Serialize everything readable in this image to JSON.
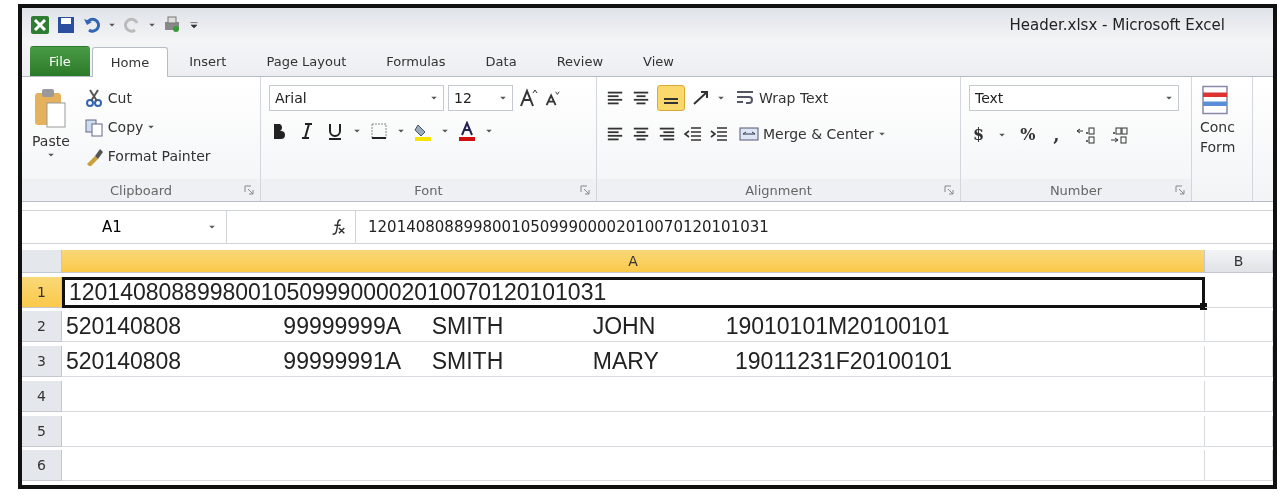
{
  "window": {
    "title": "Header.xlsx  -  Microsoft Excel"
  },
  "tabs": [
    {
      "label": "File",
      "kind": "file",
      "selected": false
    },
    {
      "label": "Home",
      "kind": "tab",
      "selected": true
    },
    {
      "label": "Insert",
      "kind": "tab",
      "selected": false
    },
    {
      "label": "Page Layout",
      "kind": "tab",
      "selected": false
    },
    {
      "label": "Formulas",
      "kind": "tab",
      "selected": false
    },
    {
      "label": "Data",
      "kind": "tab",
      "selected": false
    },
    {
      "label": "Review",
      "kind": "tab",
      "selected": false
    },
    {
      "label": "View",
      "kind": "tab",
      "selected": false
    }
  ],
  "ribbon": {
    "clipboard": {
      "paste": "Paste",
      "cut": "Cut",
      "copy": "Copy",
      "format_painter": "Format Painter",
      "label": "Clipboard"
    },
    "font": {
      "font_name": "Arial",
      "font_size": "12",
      "label": "Font"
    },
    "alignment": {
      "wrap_text": "Wrap Text",
      "merge_center": "Merge & Center",
      "label": "Alignment"
    },
    "number": {
      "format": "Text",
      "currency": "$",
      "percent": "%",
      "comma": ",",
      "label": "Number"
    },
    "conditional": {
      "line_1": "Conc",
      "line_2": "Form"
    }
  },
  "formula_bar": {
    "name_box": "A1",
    "content": "120140808899800105099900002010070120101031"
  },
  "sheet": {
    "columns": [
      {
        "label": "A",
        "selected": true
      },
      {
        "label": "B",
        "selected": false
      }
    ],
    "rows": [
      {
        "number": "1",
        "selected": true,
        "value": "120140808899800105099900002010070120101031"
      },
      {
        "number": "2",
        "selected": false,
        "value": "520140808                99999999A     SMITH              JOHN           19010101M20100101"
      },
      {
        "number": "3",
        "selected": false,
        "value": "520140808                99999991A     SMITH              MARY            19011231F20100101"
      },
      {
        "number": "4",
        "selected": false
      },
      {
        "number": "5",
        "selected": false
      },
      {
        "number": "6",
        "selected": false
      }
    ]
  }
}
